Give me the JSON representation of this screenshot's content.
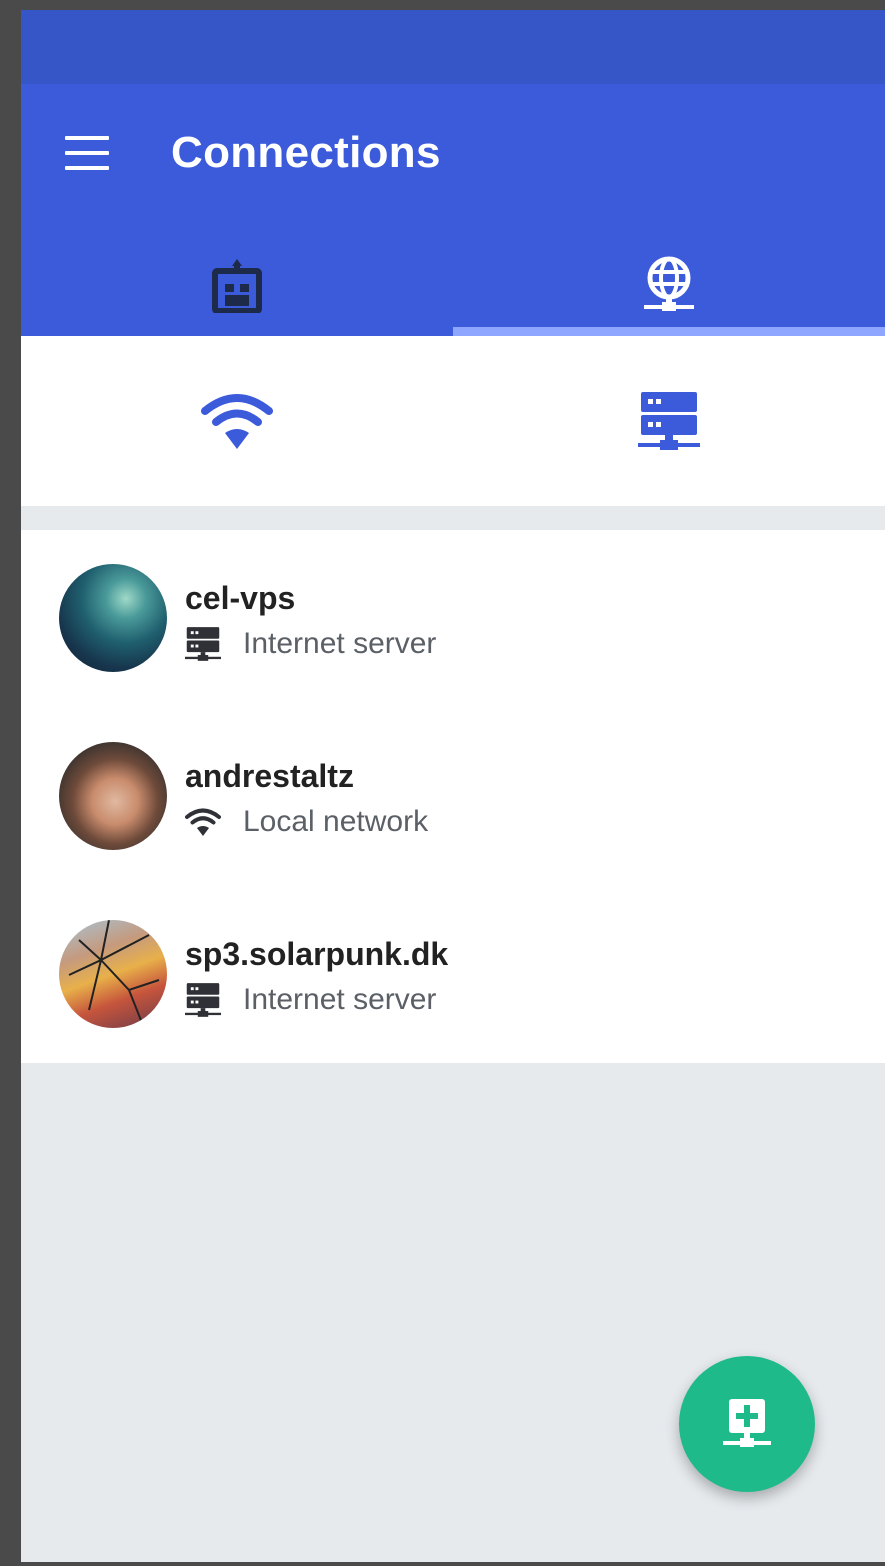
{
  "appbar": {
    "title": "Connections",
    "menu_icon": "hamburger-menu-icon"
  },
  "tabs": [
    {
      "icon": "building-icon",
      "selected": false
    },
    {
      "icon": "globe-network-icon",
      "selected": true
    }
  ],
  "subtabs": [
    {
      "icon": "wifi-icon"
    },
    {
      "icon": "server-network-icon"
    }
  ],
  "connections": [
    {
      "name": "cel-vps",
      "type_label": "Internet server",
      "type_icon": "server-icon",
      "avatar": "nebula-avatar"
    },
    {
      "name": "andrestaltz",
      "type_label": "Local network",
      "type_icon": "wifi-icon",
      "avatar": "person-avatar"
    },
    {
      "name": "sp3.solarpunk.dk",
      "type_label": "Internet server",
      "type_icon": "server-icon",
      "avatar": "cracked-glass-avatar"
    }
  ],
  "fab": {
    "icon": "add-server-icon"
  },
  "colors": {
    "primary": "#3b5bdb",
    "status_bar": "#3656c8",
    "tab_indicator": "#8ea6ff",
    "accent": "#1fba8a",
    "background": "#e6eaed"
  }
}
